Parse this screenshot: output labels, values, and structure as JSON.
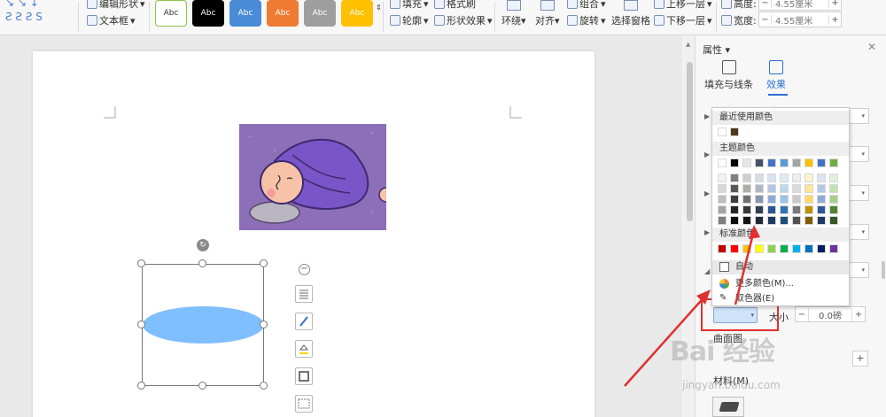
{
  "ribbon": {
    "edit_shape": "编辑形状",
    "text_box": "文本框",
    "style_buttons": [
      {
        "label": "Abc",
        "color": "#ffffff"
      },
      {
        "label": "Abc",
        "color": "#000000"
      },
      {
        "label": "Abc",
        "color": "#4a8bd8"
      },
      {
        "label": "Abc",
        "color": "#ef7b32"
      },
      {
        "label": "Abc",
        "color": "#9e9e9e"
      },
      {
        "label": "Abc",
        "color": "#ffc000"
      }
    ],
    "fill": "填充",
    "format_painter": "格式刷",
    "outline": "轮廓",
    "shape_effects": "形状效果",
    "wrap": "环绕",
    "align": "对齐",
    "group": "组合",
    "rotate": "旋转",
    "selection_pane": "选择窗格",
    "bring_forward": "上移一层",
    "send_backward": "下移一层",
    "height_label": "高度:",
    "height_value": "4.55厘米",
    "width_label": "宽度:",
    "width_value": "4.55厘米"
  },
  "panel": {
    "title": "属性",
    "tab_fill": "填充与线条",
    "tab_effects": "效果",
    "size_label": "大小",
    "size_value": "0.0磅",
    "surface_label": "曲面图",
    "material_label": "材料(M)"
  },
  "color_picker": {
    "recent_label": "最近使用颜色",
    "recent_colors": [
      "#ffffff",
      "#4a3a1c"
    ],
    "theme_label": "主题颜色",
    "theme_top": [
      "#ffffff",
      "#000000",
      "#e7e6e6",
      "#44546a",
      "#4472c4",
      "#5b9bd5",
      "#a5a5a5",
      "#ffc000",
      "#4472c4",
      "#70ad47"
    ],
    "theme_shades": [
      [
        "#f2f2f2",
        "#7f7f7f",
        "#d0cece",
        "#d6dce4",
        "#d9e2f3",
        "#deebf6",
        "#ededed",
        "#fff2cc",
        "#dae3f3",
        "#e2efd9"
      ],
      [
        "#d8d8d8",
        "#595959",
        "#aeabab",
        "#adb9ca",
        "#b4c6e7",
        "#bdd7ee",
        "#dbdbdb",
        "#fee599",
        "#b4c7e7",
        "#c5e0b3"
      ],
      [
        "#bfbfbf",
        "#3f3f3f",
        "#757070",
        "#8496b0",
        "#8eaadb",
        "#9dc3e6",
        "#c9c9c9",
        "#ffd966",
        "#8faadc",
        "#a8d08d"
      ],
      [
        "#a5a5a5",
        "#262626",
        "#3a3838",
        "#323f4f",
        "#2f5496",
        "#2e75b5",
        "#7b7b7b",
        "#bf9000",
        "#2f5597",
        "#538135"
      ],
      [
        "#7f7f7f",
        "#0c0c0c",
        "#171616",
        "#222a35",
        "#1f3864",
        "#1e4e79",
        "#525252",
        "#7f6000",
        "#203864",
        "#375623"
      ]
    ],
    "standard_label": "标准颜色",
    "standard_colors": [
      "#c00000",
      "#ff0000",
      "#ffc000",
      "#ffff00",
      "#92d050",
      "#00b050",
      "#00b0f0",
      "#0070c0",
      "#002060",
      "#7030a0"
    ],
    "auto_label": "自动",
    "more_colors": "更多颜色(M)...",
    "eyedropper": "取色器(E)",
    "current_color": "#cfe3fb"
  },
  "watermark": {
    "text": "Bai 经验",
    "url": "jingyan.baidu.com"
  }
}
